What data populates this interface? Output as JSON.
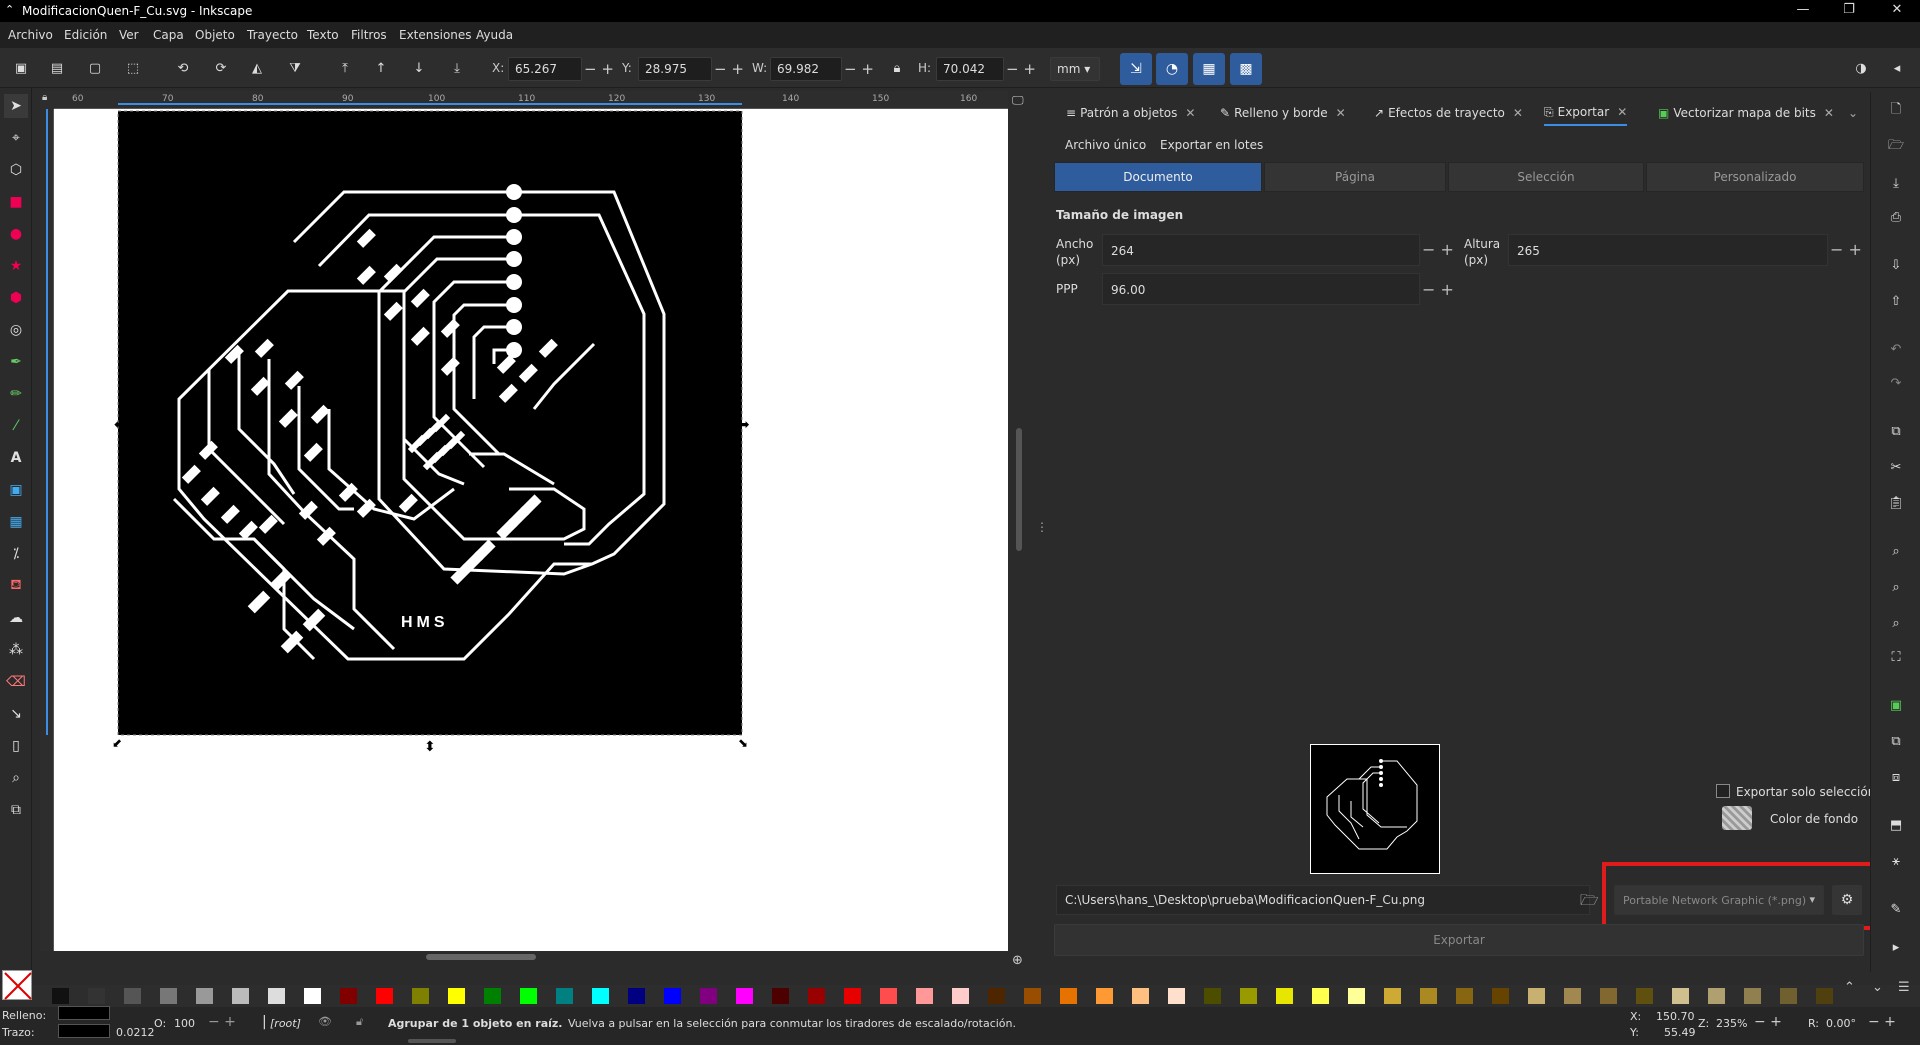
{
  "window": {
    "title": "ModificacionQuen-F_Cu.svg - Inkscape",
    "controls": [
      "—",
      "❐",
      "✕"
    ]
  },
  "menu": [
    "Archivo",
    "Edición",
    "Ver",
    "Capa",
    "Objeto",
    "Trayecto",
    "Texto",
    "Filtros",
    "Extensiones",
    "Ayuda"
  ],
  "toolcontrols": {
    "x_label": "X:",
    "x_value": "65.267",
    "y_label": "Y:",
    "y_value": "28.975",
    "w_label": "W:",
    "w_value": "69.982",
    "h_label": "H:",
    "h_value": "70.042",
    "unit": "mm"
  },
  "ruler": {
    "h_ticks": [
      "60",
      "70",
      "80",
      "90",
      "100",
      "110",
      "120",
      "130",
      "140",
      "150",
      "160"
    ]
  },
  "canvas": {
    "pcb_text": "HMS"
  },
  "dialog_tabs": [
    {
      "label": "Patrón a objetos",
      "icon": "pattern-icon"
    },
    {
      "label": "Relleno y borde",
      "icon": "fill-stroke-icon"
    },
    {
      "label": "Efectos de trayecto",
      "icon": "path-effects-icon"
    },
    {
      "label": "Exportar",
      "icon": "export-icon"
    },
    {
      "label": "Vectorizar mapa de bits",
      "icon": "trace-bitmap-icon"
    }
  ],
  "export": {
    "subtabs": [
      "Archivo único",
      "Exportar en lotes"
    ],
    "areas": [
      "Documento",
      "Página",
      "Selección",
      "Personalizado"
    ],
    "active_area": "Documento",
    "section_title": "Tamaño de imagen",
    "width_label": "Ancho\n(px)",
    "width_value": "264",
    "height_label": "Altura\n(px)",
    "height_value": "265",
    "dpi_label": "PPP",
    "dpi_value": "96.00",
    "only_selection": "Exportar solo selección",
    "bg_color": "Color de fondo",
    "filepath": "C:\\Users\\hans_\\Desktop\\prueba\\ModificacionQuen-F_Cu.png",
    "format": "Portable Network Graphic (*.png)",
    "export_button": "Exportar"
  },
  "status": {
    "fill_label": "Relleno:",
    "stroke_label": "Trazo:",
    "stroke_width": "0.0212",
    "opacity_label": "O:",
    "opacity_value": "100",
    "layer": "[root]",
    "message_bold": "Agrupar de 1 objeto en raíz.",
    "message": "Vuelva a pulsar en la selección para conmutar los tiradores de escalado/rotación.",
    "x_label": "X:",
    "x": "150.70",
    "y_label": "Y:",
    "y": "55.49",
    "zoom_label": "Z:",
    "zoom": "235%",
    "rot_label": "R:",
    "rotation": "0.00°"
  },
  "colors": {
    "accent": "#2e5c9c",
    "highlight": "#e01b1b",
    "canvas": "#ffffff",
    "pcb": "#000000"
  }
}
